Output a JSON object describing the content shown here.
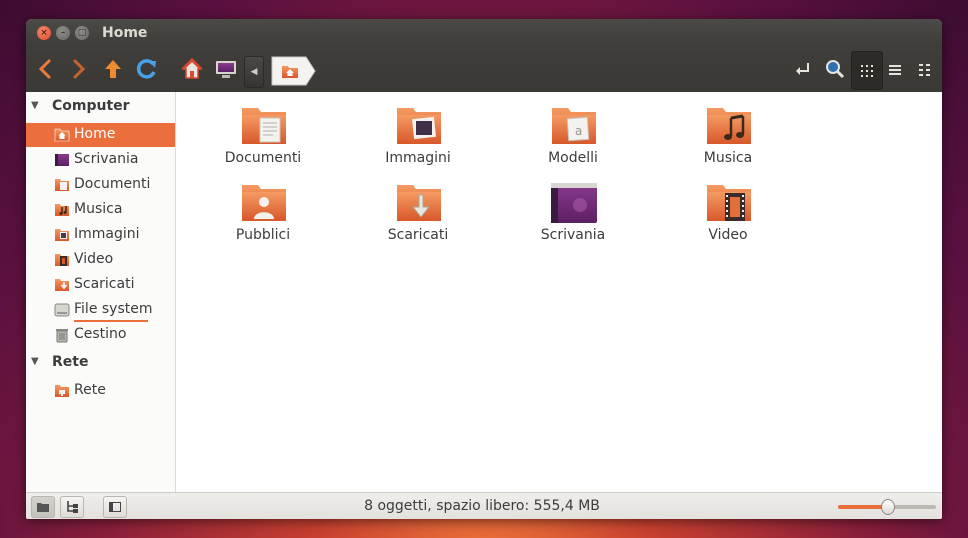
{
  "window": {
    "title": "Home",
    "buttons": [
      "close",
      "minimize",
      "maximize"
    ]
  },
  "toolbar": {
    "back_icon": "back-arrow-icon",
    "forward_icon": "forward-arrow-icon",
    "up_icon": "up-arrow-icon",
    "reload_icon": "reload-icon",
    "home_icon": "home-icon",
    "desktop_icon": "desktop-icon",
    "breadcrumb_icon": "home-folder-icon"
  },
  "sidebar": {
    "sections": [
      {
        "title": "Computer",
        "items": [
          {
            "label": "Home",
            "icon": "home-folder-icon",
            "active": true
          },
          {
            "label": "Scrivania",
            "icon": "desktop-icon"
          },
          {
            "label": "Documenti",
            "icon": "documents-folder-icon"
          },
          {
            "label": "Musica",
            "icon": "music-folder-icon"
          },
          {
            "label": "Immagini",
            "icon": "pictures-folder-icon"
          },
          {
            "label": "Video",
            "icon": "video-folder-icon"
          },
          {
            "label": "Scaricati",
            "icon": "downloads-folder-icon"
          },
          {
            "label": "File system",
            "icon": "drive-icon"
          },
          {
            "label": "Cestino",
            "icon": "trash-icon"
          }
        ]
      },
      {
        "title": "Rete",
        "items": [
          {
            "label": "Rete",
            "icon": "network-folder-icon"
          }
        ]
      }
    ]
  },
  "files": [
    {
      "name": "Documenti",
      "icon": "documents-folder-icon"
    },
    {
      "name": "Immagini",
      "icon": "pictures-folder-icon"
    },
    {
      "name": "Modelli",
      "icon": "templates-folder-icon"
    },
    {
      "name": "Musica",
      "icon": "music-folder-icon"
    },
    {
      "name": "Pubblici",
      "icon": "public-folder-icon"
    },
    {
      "name": "Scaricati",
      "icon": "downloads-folder-icon"
    },
    {
      "name": "Scrivania",
      "icon": "desktop-icon"
    },
    {
      "name": "Video",
      "icon": "video-folder-icon"
    }
  ],
  "statusbar": {
    "text": "8 oggetti, spazio libero: 555,4 MB",
    "zoom_level": 0.5
  },
  "colors": {
    "accent": "#ea6f3c",
    "folder": "#e9763f",
    "window_dark": "#3c3b37"
  }
}
